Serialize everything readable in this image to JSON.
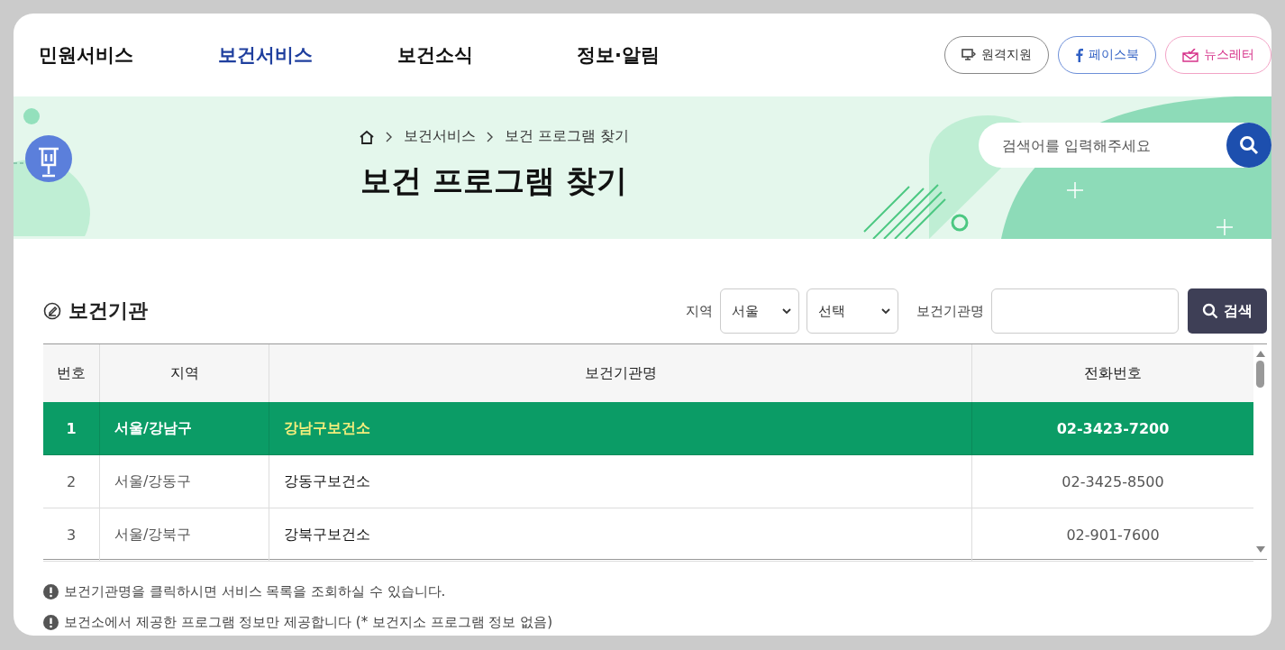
{
  "nav": [
    {
      "label": "민원서비스",
      "selected": false
    },
    {
      "label": "보건서비스",
      "selected": true
    },
    {
      "label": "보건소식",
      "selected": false
    },
    {
      "label": "정보·알림",
      "selected": false
    }
  ],
  "top_links": [
    {
      "kind": "remote",
      "label": "원격지원"
    },
    {
      "kind": "facebook",
      "label": "페이스북"
    },
    {
      "kind": "newsletter",
      "label": "뉴스레터"
    }
  ],
  "breadcrumb": [
    "보건서비스",
    "보건 프로그램 찾기"
  ],
  "page_title": "보건 프로그램 찾기",
  "site_search": {
    "placeholder": "검색어를 입력해주세요"
  },
  "section_title": "보건기관",
  "filters": {
    "region_label": "지역",
    "region": "서울",
    "district": "선택",
    "name_label": "보건기관명"
  },
  "search_button": "검색",
  "table": {
    "columns": [
      "번호",
      "지역",
      "보건기관명",
      "전화번호"
    ],
    "rows": [
      {
        "cells": [
          "1",
          "서울/강남구",
          "강남구보건소",
          "02-3423-7200"
        ],
        "selected": true
      },
      {
        "cells": [
          "2",
          "서울/강동구",
          "강동구보건소",
          "02-3425-8500"
        ],
        "selected": false
      },
      {
        "cells": [
          "3",
          "서울/강북구",
          "강북구보건소",
          "02-901-7600"
        ],
        "selected": false
      }
    ]
  },
  "notes": [
    "보건기관명을 클릭하시면 서비스 목록을 조회하실 수 있습니다.",
    "보건소에서 제공한 프로그램 정보만 제공합니다 (* 보건지소 프로그램 정보 없음)"
  ]
}
